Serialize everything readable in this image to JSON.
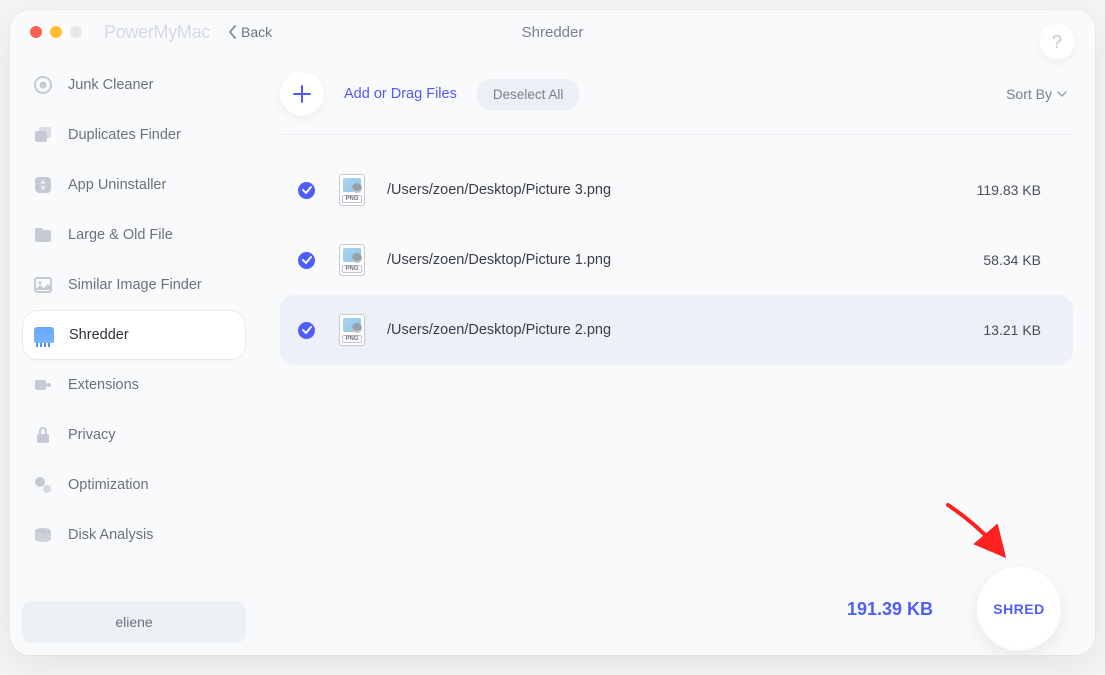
{
  "titlebar": {
    "app_name": "PowerMyMac",
    "back_label": "Back",
    "header_title": "Shredder",
    "help_label": "?"
  },
  "sidebar": {
    "items": [
      {
        "label": "Junk Cleaner",
        "icon": "junk-cleaner-icon"
      },
      {
        "label": "Duplicates Finder",
        "icon": "duplicates-icon"
      },
      {
        "label": "App Uninstaller",
        "icon": "app-uninstaller-icon"
      },
      {
        "label": "Large & Old File",
        "icon": "large-old-file-icon"
      },
      {
        "label": "Similar Image Finder",
        "icon": "similar-image-icon"
      },
      {
        "label": "Shredder",
        "icon": "shredder-icon"
      },
      {
        "label": "Extensions",
        "icon": "extensions-icon"
      },
      {
        "label": "Privacy",
        "icon": "privacy-icon"
      },
      {
        "label": "Optimization",
        "icon": "optimization-icon"
      },
      {
        "label": "Disk Analysis",
        "icon": "disk-analysis-icon"
      }
    ],
    "user_label": "eliene"
  },
  "toolbar": {
    "add_label": "Add or Drag Files",
    "deselect_label": "Deselect All",
    "sort_label": "Sort By"
  },
  "files": [
    {
      "path": "/Users/zoen/Desktop/Picture 3.png",
      "size": "119.83 KB",
      "ext": "PNG",
      "checked": true,
      "highlighted": false
    },
    {
      "path": "/Users/zoen/Desktop/Picture 1.png",
      "size": "58.34 KB",
      "ext": "PNG",
      "checked": true,
      "highlighted": false
    },
    {
      "path": "/Users/zoen/Desktop/Picture 2.png",
      "size": "13.21 KB",
      "ext": "PNG",
      "checked": true,
      "highlighted": true
    }
  ],
  "footer": {
    "total_size": "191.39 KB",
    "shred_label": "SHRED"
  }
}
